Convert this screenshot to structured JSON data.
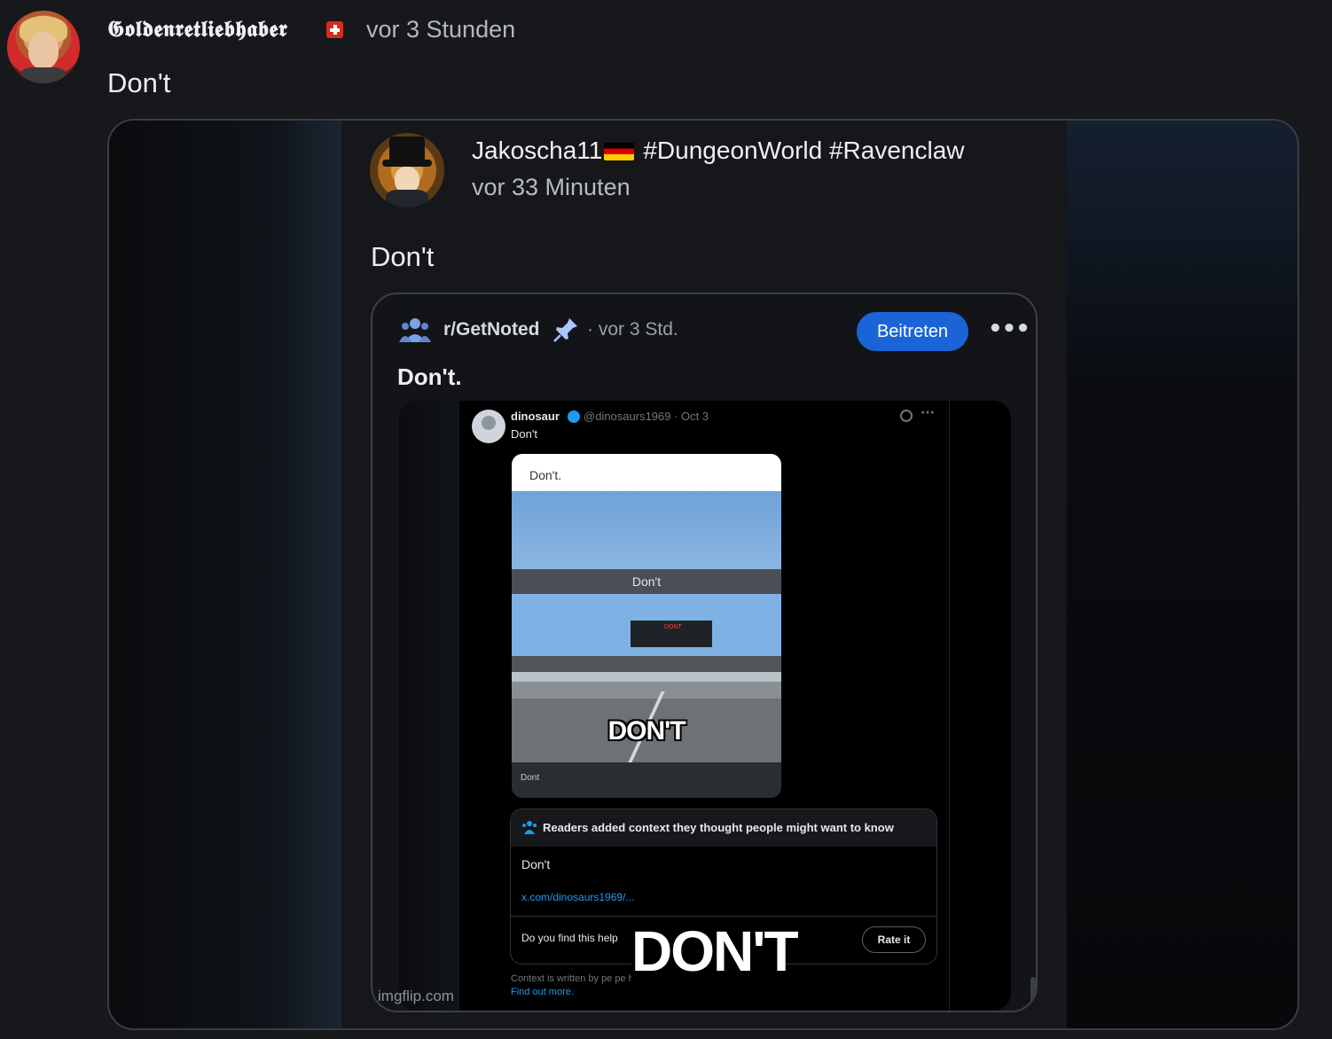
{
  "post": {
    "username": "𝕲𝖔𝖑𝖉𝖊𝖓𝖗𝖊𝖙𝖑𝖎𝖊𝖇𝖍𝖆𝖇𝖊𝖗",
    "flag_icon": "swiss-flag",
    "timestamp": "vor 3 Stunden",
    "text": "Don't"
  },
  "embed": {
    "username": "Jakoscha11",
    "flag_icon": "german-flag",
    "tags": "#DungeonWorld #Ravenclaw",
    "timestamp": "vor 33 Minuten",
    "text": "Don't",
    "reddit": {
      "community": "r/GetNoted",
      "time": "· vor 3 Std.",
      "join_label": "Beitreten",
      "more_label": "•••",
      "title": "Don't.",
      "tweet": {
        "name": "dinosaur",
        "handle": "@dinosaurs1969 · Oct 3",
        "text": "Don't",
        "more_label": "···",
        "meme": {
          "caption_top": "Don't.",
          "bar_mid": "Don't",
          "billboard": "DONT",
          "overlay": "DON'T",
          "caption_bottom": "Dont"
        },
        "note": {
          "title": "Readers added context they thought people might want to know",
          "body": "Don't",
          "link": "x.com/dinosaurs1969/...",
          "question": "Do you find this help",
          "rate_label": "Rate it"
        },
        "footer1": "Context is written by pe                              pe     hen rated helpful by others.",
        "footer2": "Find out more."
      },
      "big_overlay": "DON'T",
      "watermark": "imgflip.com"
    }
  }
}
